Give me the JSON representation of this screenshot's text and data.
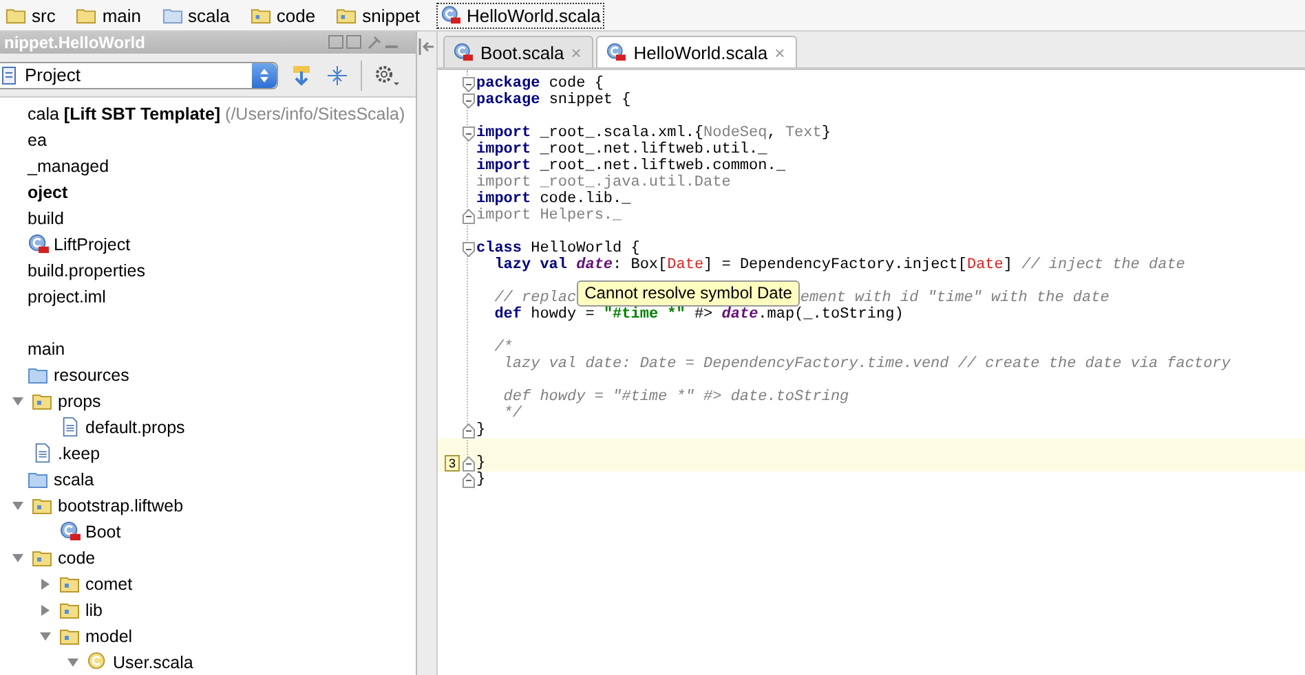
{
  "breadcrumb": [
    {
      "kind": "folder",
      "label": "src"
    },
    {
      "kind": "folder",
      "label": "main"
    },
    {
      "kind": "source",
      "label": "scala"
    },
    {
      "kind": "package",
      "label": "code"
    },
    {
      "kind": "package",
      "label": "snippet"
    },
    {
      "kind": "class",
      "label": "HelloWorld.scala",
      "selected": true
    }
  ],
  "project_panel": {
    "title": "nippet.HelloWorld",
    "view": "Project",
    "tree": [
      {
        "kind": "root",
        "label": "cala ",
        "bold_part": "[Lift SBT Template]",
        "path": " (/Users/info/SitesScala)"
      },
      {
        "kind": "plain",
        "label": "ea"
      },
      {
        "kind": "plain",
        "label": "_managed"
      },
      {
        "kind": "module",
        "label": "oject"
      },
      {
        "kind": "plain",
        "label": "build"
      },
      {
        "kind": "class",
        "label": "LiftProject"
      },
      {
        "kind": "plain",
        "label": "build.properties"
      },
      {
        "kind": "plain",
        "label": "project.iml"
      },
      {
        "kind": "spacer"
      },
      {
        "kind": "plain",
        "label": "main"
      },
      {
        "kind": "source",
        "label": "resources",
        "children": [
          {
            "kind": "package",
            "label": "props",
            "expanded": true,
            "children": [
              {
                "kind": "file",
                "label": "default.props"
              }
            ]
          },
          {
            "kind": "file",
            "label": ".keep"
          }
        ]
      },
      {
        "kind": "source",
        "label": "scala",
        "children": [
          {
            "kind": "package",
            "label": "bootstrap.liftweb",
            "expanded": true,
            "children": [
              {
                "kind": "class",
                "label": "Boot"
              }
            ]
          },
          {
            "kind": "package",
            "label": "code",
            "expanded": true,
            "children": [
              {
                "kind": "package",
                "label": "comet",
                "expanded": false
              },
              {
                "kind": "package",
                "label": "lib",
                "expanded": false
              },
              {
                "kind": "package",
                "label": "model",
                "expanded": true,
                "children": [
                  {
                    "kind": "object",
                    "label": "User.scala",
                    "expanded": true
                  }
                ]
              }
            ]
          }
        ]
      }
    ]
  },
  "tabs": [
    {
      "label": "Boot.scala",
      "close": "×",
      "selected": false
    },
    {
      "label": "HelloWorld.scala",
      "close": "×",
      "selected": true
    }
  ],
  "editor": {
    "lines": [
      {
        "fold_open": true,
        "tokens": [
          {
            "kind": "keyword",
            "text": "package"
          },
          {
            "kind": "text",
            "text": " code {"
          }
        ]
      },
      {
        "fold_open": true,
        "tokens": [
          {
            "kind": "keyword",
            "text": "package"
          },
          {
            "kind": "text",
            "text": " snippet {"
          }
        ]
      },
      {
        "gap_before": true,
        "fold_open": true,
        "tokens": [
          {
            "kind": "keyword",
            "text": "import"
          },
          {
            "kind": "text",
            "text": " _root_.scala.xml.{"
          },
          {
            "kind": "unused",
            "text": "NodeSeq"
          },
          {
            "kind": "text",
            "text": ", "
          },
          {
            "kind": "unused",
            "text": "Text"
          },
          {
            "kind": "text",
            "text": "}"
          }
        ]
      },
      {
        "tokens": [
          {
            "kind": "keyword",
            "text": "import"
          },
          {
            "kind": "text",
            "text": " _root_.net.liftweb.util._"
          }
        ]
      },
      {
        "tokens": [
          {
            "kind": "keyword",
            "text": "import"
          },
          {
            "kind": "text",
            "text": " _root_.net.liftweb.common._"
          }
        ]
      },
      {
        "tokens": [
          {
            "kind": "unused",
            "text": "import _root_.java.util.Date"
          }
        ]
      },
      {
        "tokens": [
          {
            "kind": "keyword",
            "text": "import"
          },
          {
            "kind": "text",
            "text": " code.lib._"
          }
        ]
      },
      {
        "fold_close": true,
        "tokens": [
          {
            "kind": "unused",
            "text": "import Helpers._"
          }
        ]
      },
      {
        "gap_before": true,
        "fold_open": true,
        "tokens": [
          {
            "kind": "keyword",
            "text": "class"
          },
          {
            "kind": "text",
            "text": " HelloWorld {"
          }
        ]
      },
      {
        "tokens": [
          {
            "kind": "keyword",
            "text": "  lazy val"
          },
          {
            "kind": "field",
            "text": " date"
          },
          {
            "kind": "text",
            "text": ": Box["
          },
          {
            "kind": "error",
            "text": "Date"
          },
          {
            "kind": "text",
            "text": "] = DependencyFactory.inject["
          },
          {
            "kind": "error",
            "text": "Date"
          },
          {
            "kind": "text",
            "text": "] "
          },
          {
            "kind": "comment",
            "text": "// inject the date"
          }
        ]
      },
      {
        "gap_before": true,
        "tokens": [
          {
            "kind": "comment",
            "text": "  // replac"
          },
          {
            "kind": "tooltip",
            "text": "Cannot resolve symbol Date"
          },
          {
            "kind": "comment",
            "text": "ement with id \"time\" with the date"
          }
        ]
      },
      {
        "tokens": [
          {
            "kind": "keyword",
            "text": "  def"
          },
          {
            "kind": "text",
            "text": " howdy = "
          },
          {
            "kind": "string",
            "text": "\"#time *\""
          },
          {
            "kind": "text",
            "text": " #> "
          },
          {
            "kind": "field",
            "text": "date"
          },
          {
            "kind": "text",
            "text": ".map(_.toString)"
          }
        ]
      },
      {
        "gap_before": true,
        "tokens": [
          {
            "kind": "comment",
            "text": "  /*"
          }
        ]
      },
      {
        "tokens": [
          {
            "kind": "comment",
            "text": "   lazy val date: Date = DependencyFactory.time.vend // create the date via factory"
          }
        ]
      },
      {
        "gap_before": true,
        "tokens": [
          {
            "kind": "comment",
            "text": "   def howdy = \"#time *\" #> date.toString"
          }
        ]
      },
      {
        "tokens": [
          {
            "kind": "comment",
            "text": "   */"
          }
        ]
      },
      {
        "fold_close": true,
        "tokens": [
          {
            "kind": "text",
            "text": "}"
          }
        ]
      },
      {
        "gap_before": true,
        "fold_close": true,
        "current": true,
        "marker": "3",
        "tokens": [
          {
            "kind": "text",
            "text": "}"
          }
        ]
      },
      {
        "fold_close": true,
        "tokens": [
          {
            "kind": "text",
            "text": "}"
          }
        ]
      }
    ]
  }
}
